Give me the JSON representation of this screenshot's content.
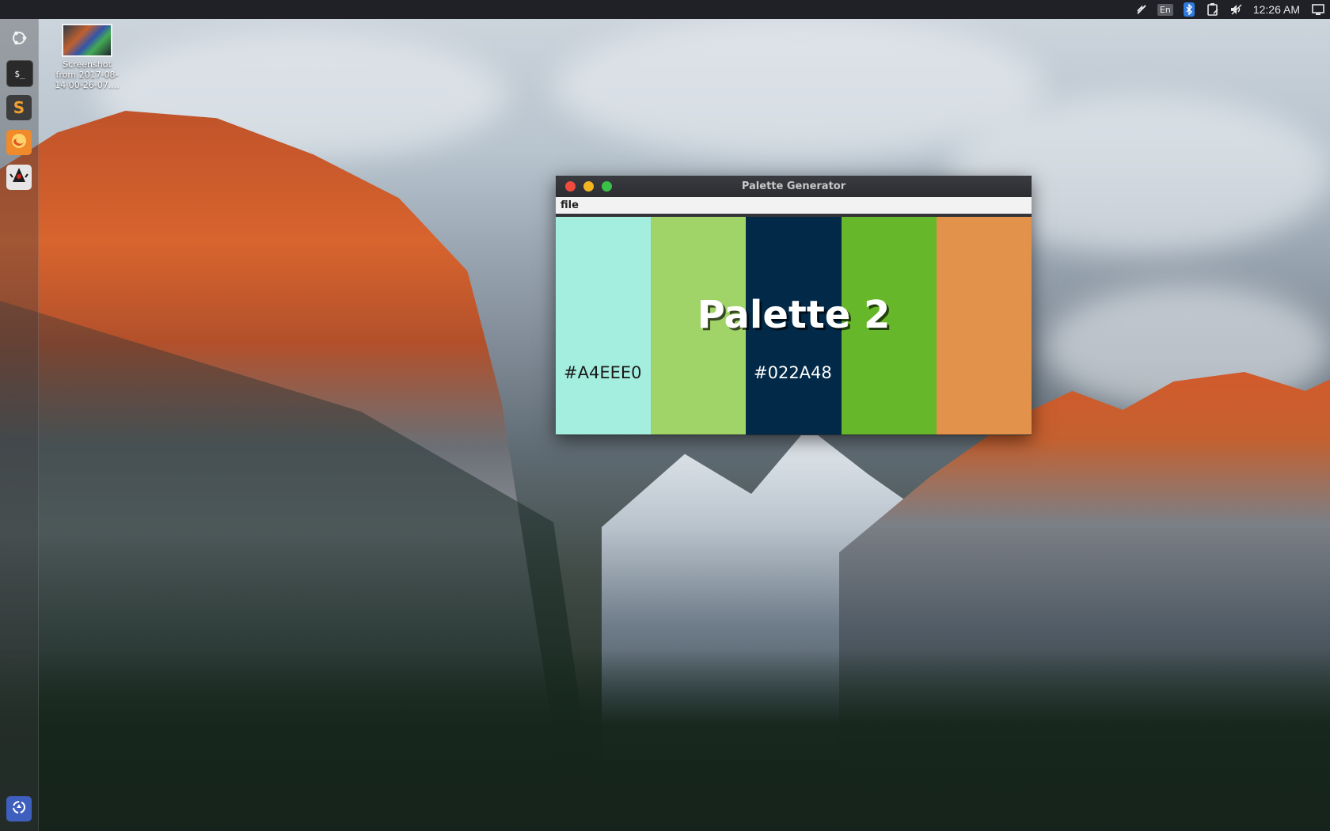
{
  "top_panel": {
    "keyboard_layout": "En",
    "clock": "12:26 AM"
  },
  "launcher": {
    "items": [
      {
        "name": "dash-home",
        "icon": "ubuntu-logo-icon"
      },
      {
        "name": "terminal",
        "icon": "terminal-icon",
        "glyph": "$_"
      },
      {
        "name": "sublime-text",
        "icon": "sublime-text-icon",
        "glyph": "S"
      },
      {
        "name": "firefox",
        "icon": "firefox-icon"
      },
      {
        "name": "java-app",
        "icon": "java-duke-icon"
      },
      {
        "name": "trash",
        "icon": "trash-icon"
      }
    ]
  },
  "desktop": {
    "icon_label": "Screenshot from 2017-08-14 00-26-07...."
  },
  "window": {
    "title": "Palette Generator",
    "menu": [
      "file"
    ],
    "palette_title": "Palette 2",
    "swatches": [
      {
        "color": "#A4EEE0",
        "label": "#A4EEE0",
        "label_color": "#1a1a1a"
      },
      {
        "color": "#A0D469",
        "label": "",
        "label_color": "#1a1a1a"
      },
      {
        "color": "#022A48",
        "label": "#022A48",
        "label_color": "#ffffff"
      },
      {
        "color": "#66B82A",
        "label": "",
        "label_color": "#1a1a1a"
      },
      {
        "color": "#E2924A",
        "label": "",
        "label_color": "#1a1a1a"
      }
    ]
  }
}
